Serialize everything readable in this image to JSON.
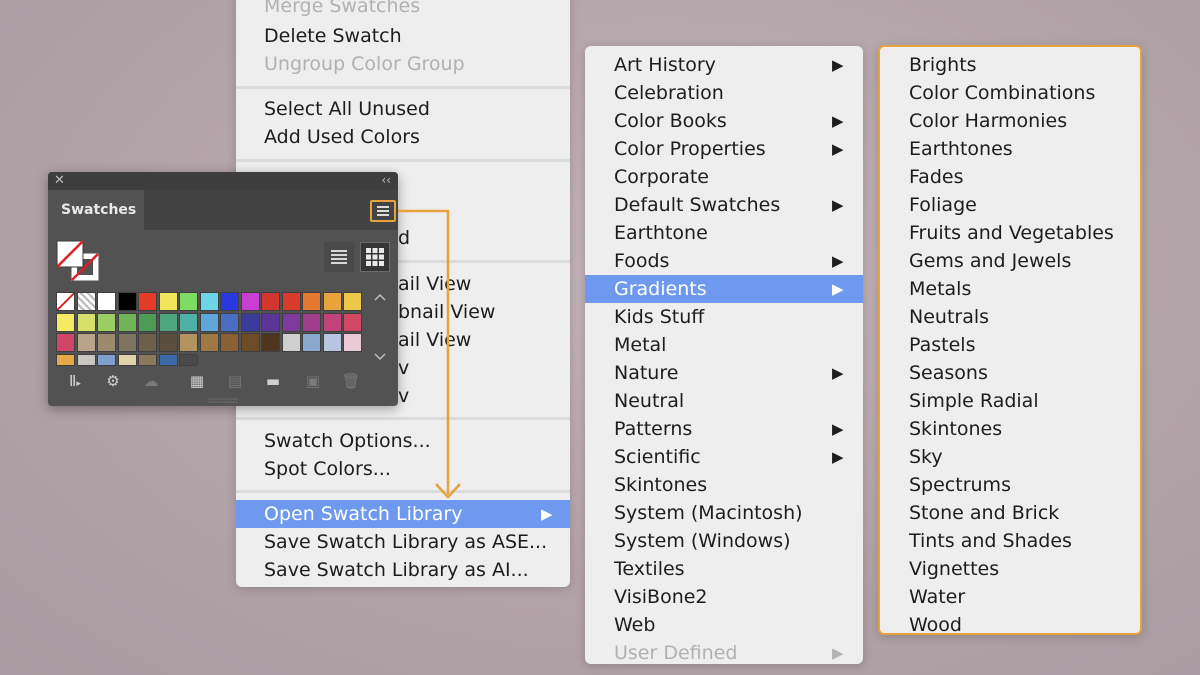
{
  "panel_menu": {
    "items": [
      {
        "label": "Merge Swatches",
        "disabled": true
      },
      {
        "label": "Delete Swatch",
        "disabled": false
      },
      {
        "label": "Ungroup Color Group",
        "disabled": true
      },
      {
        "label": "Select All Unused",
        "disabled": false
      },
      {
        "label": "Add Used Colors",
        "disabled": false
      },
      {
        "label": "d"
      },
      {
        "label": "ail View"
      },
      {
        "label": "bnail View"
      },
      {
        "label": "ail View"
      },
      {
        "label": "v"
      },
      {
        "label": "v"
      },
      {
        "label": "Swatch Options...",
        "disabled": false
      },
      {
        "label": "Spot Colors...",
        "disabled": false
      },
      {
        "label": "Open Swatch Library",
        "highlighted": true,
        "submenu": true
      },
      {
        "label": "Save Swatch Library as ASE...",
        "disabled": false
      },
      {
        "label": "Save Swatch Library as AI...",
        "disabled": false
      }
    ],
    "arrow_glyph": "▶"
  },
  "library_menu": {
    "items": [
      {
        "label": "Art History",
        "submenu": true
      },
      {
        "label": "Celebration"
      },
      {
        "label": "Color Books",
        "submenu": true
      },
      {
        "label": "Color Properties",
        "submenu": true
      },
      {
        "label": "Corporate"
      },
      {
        "label": "Default Swatches",
        "submenu": true
      },
      {
        "label": "Earthtone"
      },
      {
        "label": "Foods",
        "submenu": true
      },
      {
        "label": "Gradients",
        "submenu": true,
        "highlighted": true
      },
      {
        "label": "Kids Stuff"
      },
      {
        "label": "Metal"
      },
      {
        "label": "Nature",
        "submenu": true
      },
      {
        "label": "Neutral"
      },
      {
        "label": "Patterns",
        "submenu": true
      },
      {
        "label": "Scientific",
        "submenu": true
      },
      {
        "label": "Skintones"
      },
      {
        "label": "System (Macintosh)"
      },
      {
        "label": "System (Windows)"
      },
      {
        "label": "Textiles"
      },
      {
        "label": "VisiBone2"
      },
      {
        "label": "Web"
      },
      {
        "label": "User Defined",
        "submenu": true,
        "disabled": true
      }
    ]
  },
  "gradients_menu": {
    "items": [
      "Brights",
      "Color Combinations",
      "Color Harmonies",
      "Earthtones",
      "Fades",
      "Foliage",
      "Fruits and Vegetables",
      "Gems and Jewels",
      "Metals",
      "Neutrals",
      "Pastels",
      "Seasons",
      "Simple Radial",
      "Skintones",
      "Sky",
      "Spectrums",
      "Stone and Brick",
      "Tints and Shades",
      "Vignettes",
      "Water",
      "Wood"
    ]
  },
  "swatches_panel": {
    "close_glyph": "✕",
    "collapse_glyph": "‹‹",
    "tab_label": "Swatches",
    "swatch_colors": [
      "none",
      "registration",
      "#ffffff",
      "#000000",
      "#e23b2a",
      "#f3e55a",
      "#7ddc62",
      "#6cd6e6",
      "#2938e0",
      "#c63fd2",
      "#d2372f",
      "#d83a2c",
      "#e57a2f",
      "#e8a43a",
      "#ecc94a",
      "#f5ea62",
      "#d6e06a",
      "#9ccf63",
      "#6fb557",
      "#4d9b57",
      "#4ea67e",
      "#4fb0a6",
      "#5fa6da",
      "#4a6ec3",
      "#3c3a9a",
      "#5b3596",
      "#7d3b9c",
      "#a23d8c",
      "#c2437c",
      "#d24764",
      "#d04568",
      "#b9a489",
      "#9c8a6d",
      "#7e7360",
      "#6c5f4c",
      "#5a4e3f",
      "#b49360",
      "#a07843",
      "#8a6133",
      "#6d4b27",
      "#4e3520",
      "#cfcfcf",
      "#8aa7d0",
      "#b8c5e0",
      "#e9c9d6",
      "#e8a94b",
      "#c9c5c0",
      "#7f9fcf",
      "#e0d4a8",
      "#8a7a5a",
      "#3c6aa8",
      "#4a4a4a"
    ]
  }
}
